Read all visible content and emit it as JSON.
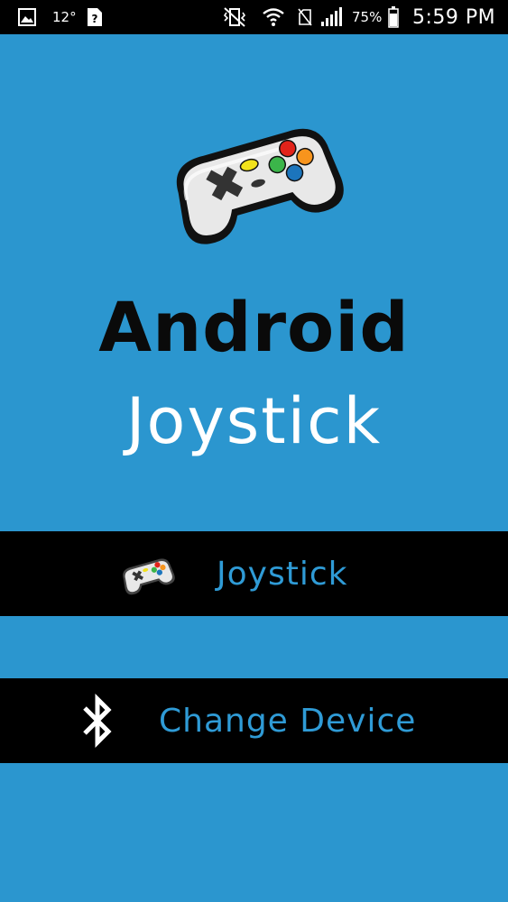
{
  "status_bar": {
    "temperature": "12°",
    "battery_percent": "75%",
    "time": "5:59 PM",
    "icons": [
      "gallery-icon",
      "unknown-notification-icon",
      "vibrate-icon",
      "wifi-icon",
      "no-sim-icon",
      "signal-icon",
      "battery-icon"
    ]
  },
  "hero": {
    "title_line1": "Android",
    "title_line2": "Joystick",
    "logo_icon": "gamepad-icon"
  },
  "menu": {
    "joystick_label": "Joystick",
    "joystick_icon": "gamepad-icon",
    "change_device_label": "Change Device",
    "change_device_icon": "bluetooth-icon"
  },
  "colors": {
    "background": "#2b96cf",
    "button_background": "#000000",
    "button_text": "#2f9bd6",
    "title_dark": "#0a0a0a",
    "title_light": "#ffffff"
  }
}
